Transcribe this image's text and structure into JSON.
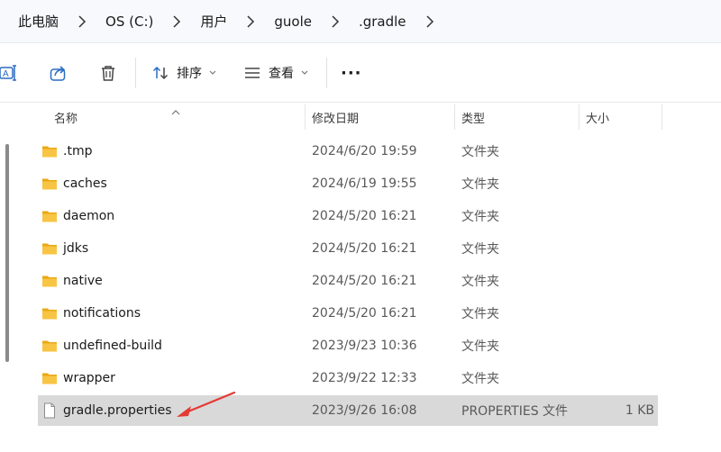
{
  "breadcrumb": {
    "items": [
      {
        "label": "此电脑"
      },
      {
        "label": "OS (C:)"
      },
      {
        "label": "用户"
      },
      {
        "label": "guole"
      },
      {
        "label": ".gradle"
      }
    ]
  },
  "toolbar": {
    "sort_label": "排序",
    "view_label": "查看",
    "more_label": "···"
  },
  "columns": {
    "name": "名称",
    "modified": "修改日期",
    "type": "类型",
    "size": "大小"
  },
  "files": [
    {
      "name": ".tmp",
      "modified": "2024/6/20 19:59",
      "type": "文件夹",
      "size": "",
      "kind": "folder"
    },
    {
      "name": "caches",
      "modified": "2024/6/19 19:55",
      "type": "文件夹",
      "size": "",
      "kind": "folder"
    },
    {
      "name": "daemon",
      "modified": "2024/5/20 16:21",
      "type": "文件夹",
      "size": "",
      "kind": "folder"
    },
    {
      "name": "jdks",
      "modified": "2024/5/20 16:21",
      "type": "文件夹",
      "size": "",
      "kind": "folder"
    },
    {
      "name": "native",
      "modified": "2024/5/20 16:21",
      "type": "文件夹",
      "size": "",
      "kind": "folder"
    },
    {
      "name": "notifications",
      "modified": "2024/5/20 16:21",
      "type": "文件夹",
      "size": "",
      "kind": "folder"
    },
    {
      "name": "undefined-build",
      "modified": "2023/9/23 10:36",
      "type": "文件夹",
      "size": "",
      "kind": "folder"
    },
    {
      "name": "wrapper",
      "modified": "2023/9/22 12:33",
      "type": "文件夹",
      "size": "",
      "kind": "folder"
    },
    {
      "name": "gradle.properties",
      "modified": "2023/9/26 16:08",
      "type": "PROPERTIES 文件",
      "size": "1 KB",
      "kind": "file",
      "selected": true
    }
  ],
  "colors": {
    "folder": "#f8c443",
    "folder_dark": "#e9a915",
    "selection": "#d9d9d9",
    "annotation_arrow": "#e53935",
    "accent": "#2b6cc4"
  }
}
